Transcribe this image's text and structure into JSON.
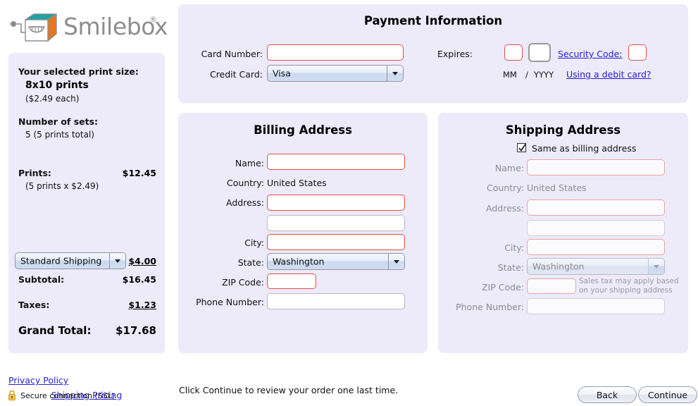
{
  "brand": {
    "name": "Smilebox",
    "registered_mark": "®",
    "logo_colors": {
      "top": "#17a5a5",
      "side": "#e8761e",
      "outline": "#8d8d8d"
    }
  },
  "sidebar": {
    "print_size_label": "Your selected print size:",
    "print_size_value": "8x10 prints",
    "print_unit_price": "($2.49 each)",
    "sets_label": "Number of sets:",
    "sets_value": "5 (5 prints total)",
    "prints_label": "Prints:",
    "prints_amount": "$12.45",
    "prints_detail": "(5 prints x $2.49)",
    "shipping_option": "Standard Shipping",
    "shipping_amount": "$4.00",
    "subtotal_label": "Subtotal:",
    "subtotal_amount": "$16.45",
    "taxes_label": "Taxes:",
    "taxes_amount": "$1.23",
    "grand_total_label": "Grand Total:",
    "grand_total_amount": "$17.68",
    "shipping_pricing_link": "Shipping Pricing"
  },
  "payment": {
    "title": "Payment Information",
    "card_number_label": "Card Number:",
    "card_number_value": "",
    "credit_card_label": "Credit Card:",
    "credit_card_value": "Visa",
    "expires_label": "Expires:",
    "expires_month_value": "",
    "expires_year_value": "",
    "expires_hint_mm": "MM",
    "expires_hint_slash": "/",
    "expires_hint_yyyy": "YYYY",
    "security_code_link": "Security Code:",
    "security_code_value": "",
    "debit_card_link": "Using a debit card?"
  },
  "billing": {
    "title": "Billing Address",
    "name_label": "Name:",
    "name_value": "",
    "country_label": "Country:",
    "country_value": "United States",
    "address_label": "Address:",
    "address1_value": "",
    "address2_value": "",
    "city_label": "City:",
    "city_value": "",
    "state_label": "State:",
    "state_value": "Washington",
    "zip_label": "ZIP Code:",
    "zip_value": "",
    "phone_label": "Phone Number:",
    "phone_value": ""
  },
  "shipping": {
    "title": "Shipping Address",
    "same_as_billing_label": "Same as billing address",
    "same_as_billing_checked": true,
    "name_label": "Name:",
    "name_value": "",
    "country_label": "Country:",
    "country_value": "United States",
    "address_label": "Address:",
    "address1_value": "",
    "address2_value": "",
    "city_label": "City:",
    "city_value": "",
    "state_label": "State:",
    "state_value": "Washington",
    "zip_label": "ZIP Code:",
    "zip_value": "",
    "tax_note_line1": "Sales tax may apply based",
    "tax_note_line2": "on your shipping address",
    "phone_label": "Phone Number:",
    "phone_value": ""
  },
  "footer": {
    "privacy_policy_link": "Privacy Policy",
    "ssl_text": "Secure connection (SSL)",
    "continue_note": "Click Continue to review your order one last time.",
    "back_button": "Back",
    "continue_button": "Continue"
  }
}
